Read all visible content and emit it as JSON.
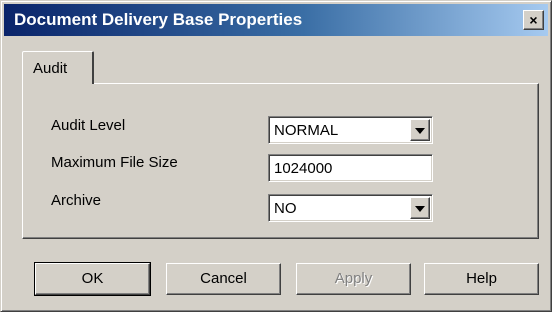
{
  "window": {
    "title": "Document Delivery Base Properties",
    "close_symbol": "×"
  },
  "tabs": [
    {
      "label": "Audit",
      "selected": true
    }
  ],
  "form": {
    "audit_level": {
      "label": "Audit Level",
      "value": "NORMAL"
    },
    "max_file_size": {
      "label": "Maximum File Size",
      "value": "1024000"
    },
    "archive": {
      "label": "Archive",
      "value": "NO"
    }
  },
  "buttons": {
    "ok": "OK",
    "cancel": "Cancel",
    "apply": "Apply",
    "help": "Help"
  },
  "colors": {
    "titlebar_start": "#0a246a",
    "titlebar_end": "#a6caf0",
    "face": "#d4d0c8"
  }
}
